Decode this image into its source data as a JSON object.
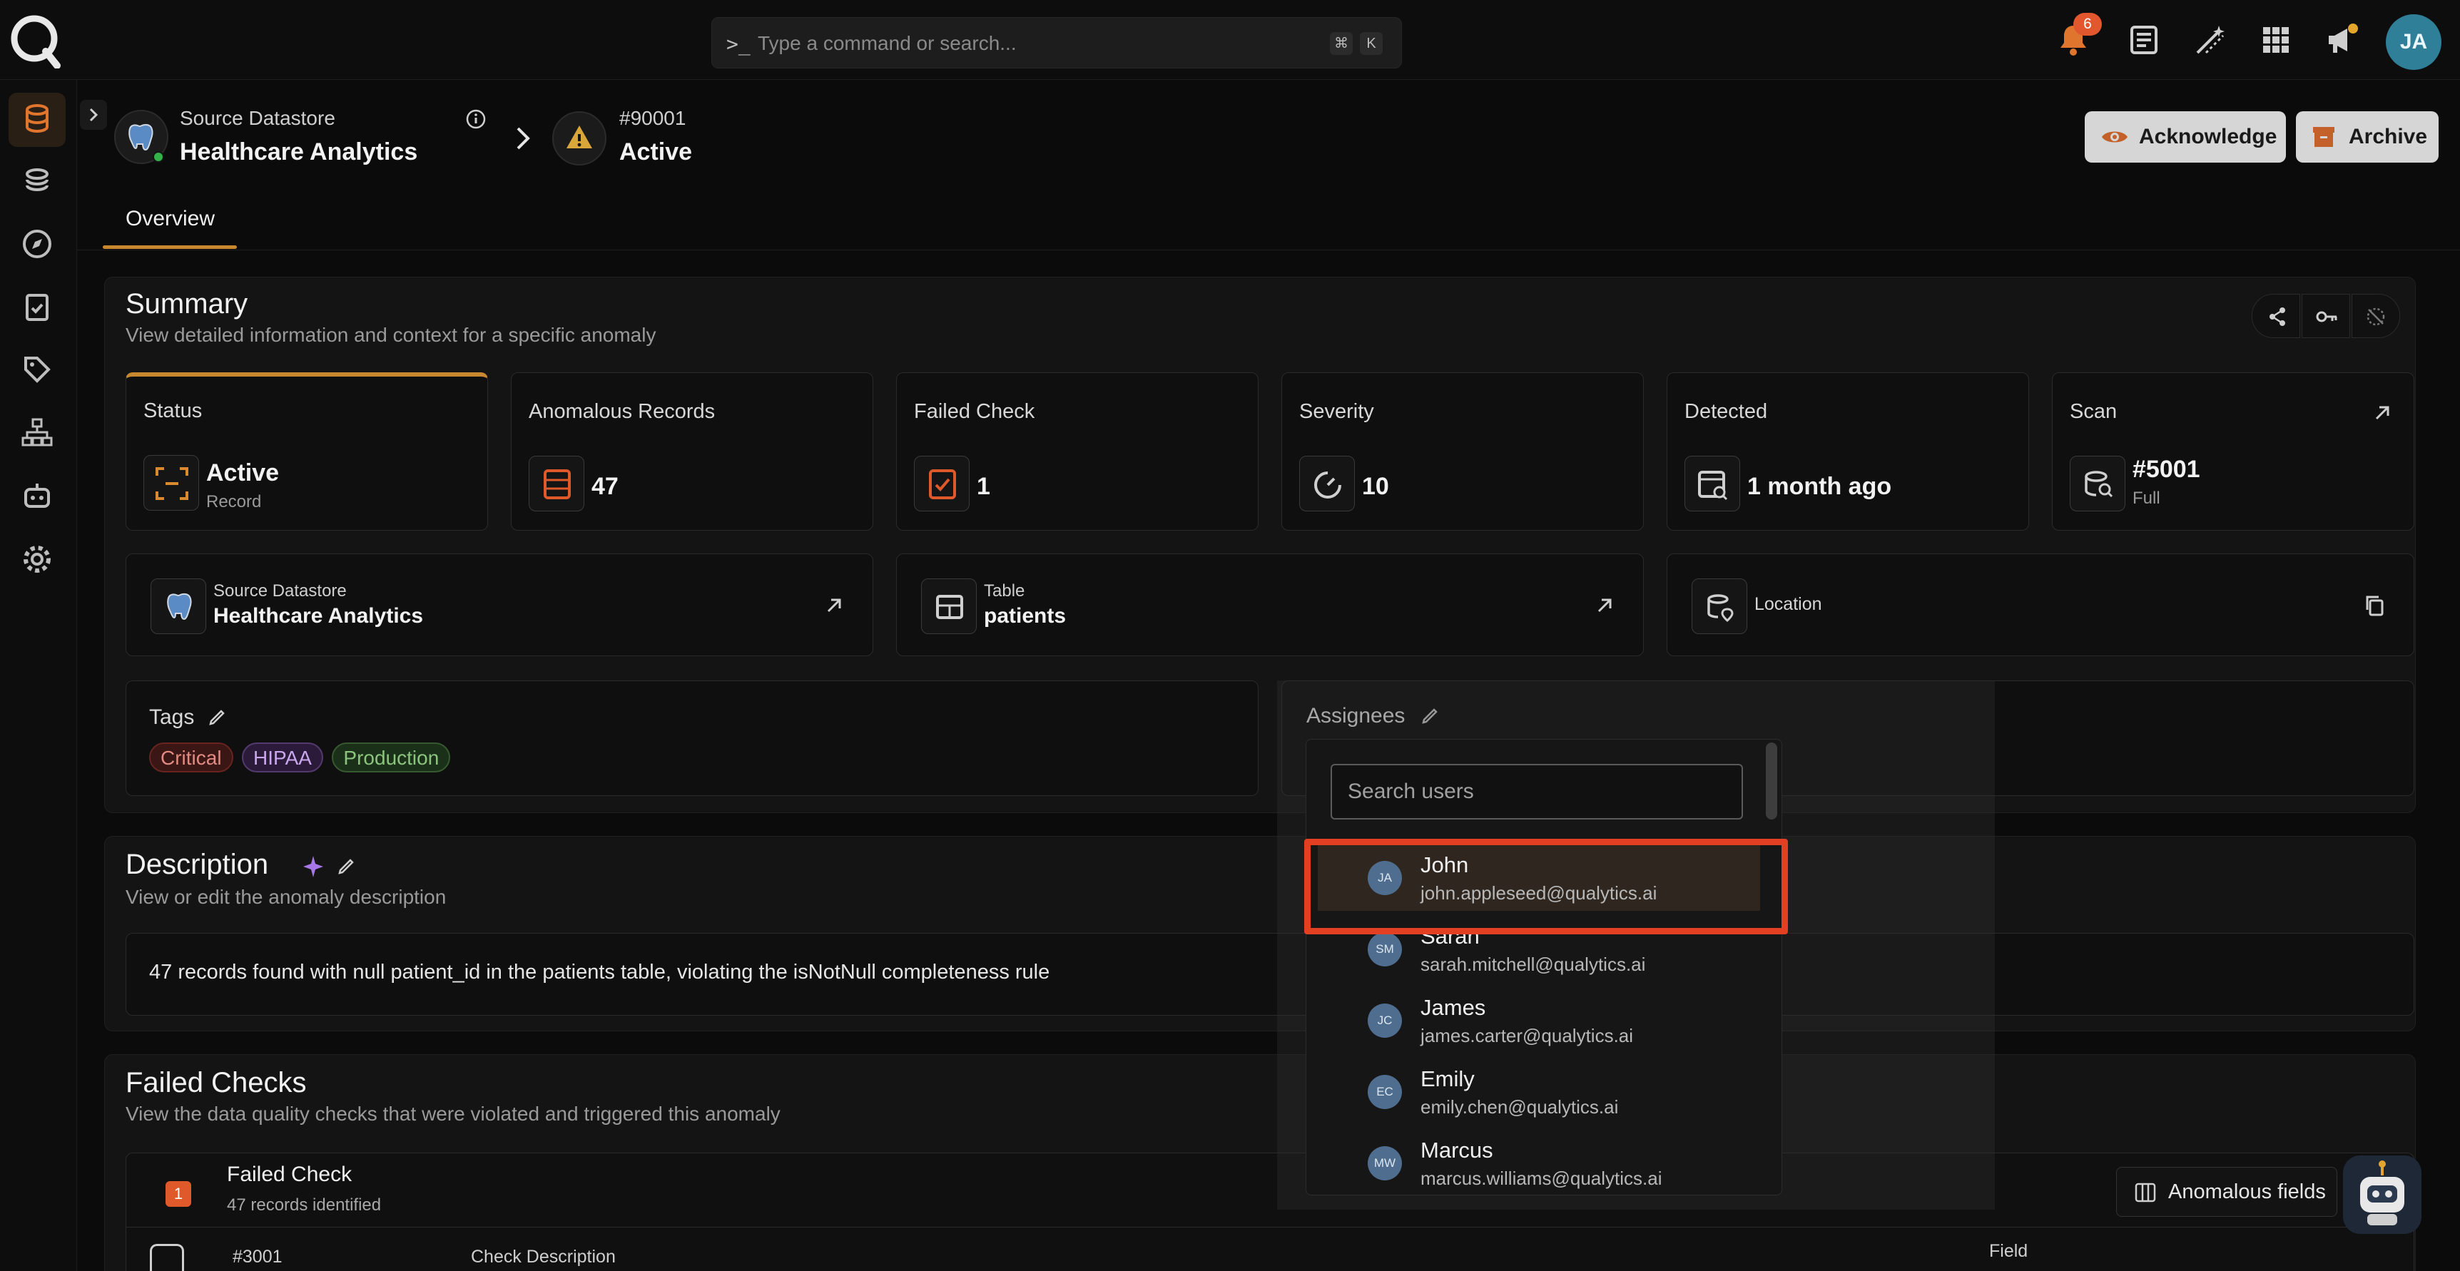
{
  "topbar": {
    "command_placeholder": "Type a command or search...",
    "shortcut_keys": [
      "⌘",
      "K"
    ],
    "notifications_count": "6",
    "user_initials": "JA"
  },
  "header": {
    "datastore_label": "Source Datastore",
    "datastore_name": "Healthcare Analytics",
    "anomaly_id": "#90001",
    "anomaly_status": "Active",
    "acknowledge_label": "Acknowledge",
    "archive_label": "Archive"
  },
  "tabs": [
    {
      "label": "Overview"
    }
  ],
  "summary": {
    "title": "Summary",
    "subtitle": "View detailed information and context for a specific anomaly",
    "cards": {
      "status": {
        "label": "Status",
        "value": "Active",
        "sub": "Record"
      },
      "records": {
        "label": "Anomalous Records",
        "value": "47"
      },
      "failed": {
        "label": "Failed Check",
        "value": "1"
      },
      "severity": {
        "label": "Severity",
        "value": "10"
      },
      "detected": {
        "label": "Detected",
        "value": "1 month ago"
      },
      "scan": {
        "label": "Scan",
        "value": "#5001",
        "sub": "Full"
      }
    },
    "source": {
      "label": "Source Datastore",
      "value": "Healthcare Analytics"
    },
    "table": {
      "label": "Table",
      "value": "patients"
    },
    "location": {
      "label": "Location"
    },
    "tags": {
      "label": "Tags",
      "items": [
        "Critical",
        "HIPAA",
        "Production"
      ]
    },
    "assignees": {
      "label": "Assignees"
    }
  },
  "assignee_dropdown": {
    "search_placeholder": "Search users",
    "users": [
      {
        "initials": "JA",
        "name": "John",
        "email": "john.appleseed@qualytics.ai"
      },
      {
        "initials": "SM",
        "name": "Sarah",
        "email": "sarah.mitchell@qualytics.ai"
      },
      {
        "initials": "JC",
        "name": "James",
        "email": "james.carter@qualytics.ai"
      },
      {
        "initials": "EC",
        "name": "Emily",
        "email": "emily.chen@qualytics.ai"
      },
      {
        "initials": "MW",
        "name": "Marcus",
        "email": "marcus.williams@qualytics.ai"
      }
    ]
  },
  "description": {
    "title": "Description",
    "subtitle": "View or edit the anomaly description",
    "text": "47 records found with null patient_id in the patients table, violating the isNotNull completeness rule"
  },
  "failed_checks": {
    "title": "Failed Checks",
    "subtitle": "View the data quality checks that were violated and triggered this anomaly",
    "count_badge": "1",
    "header_label": "Failed Check",
    "header_sub": "47 records identified",
    "anomalous_fields_label": "Anomalous fields",
    "row_id": "#3001",
    "col_check_description": "Check Description",
    "col_field": "Field"
  },
  "colors": {
    "accent": "#c9872f",
    "highlight": "#e23f23",
    "notification": "#e3572e"
  }
}
